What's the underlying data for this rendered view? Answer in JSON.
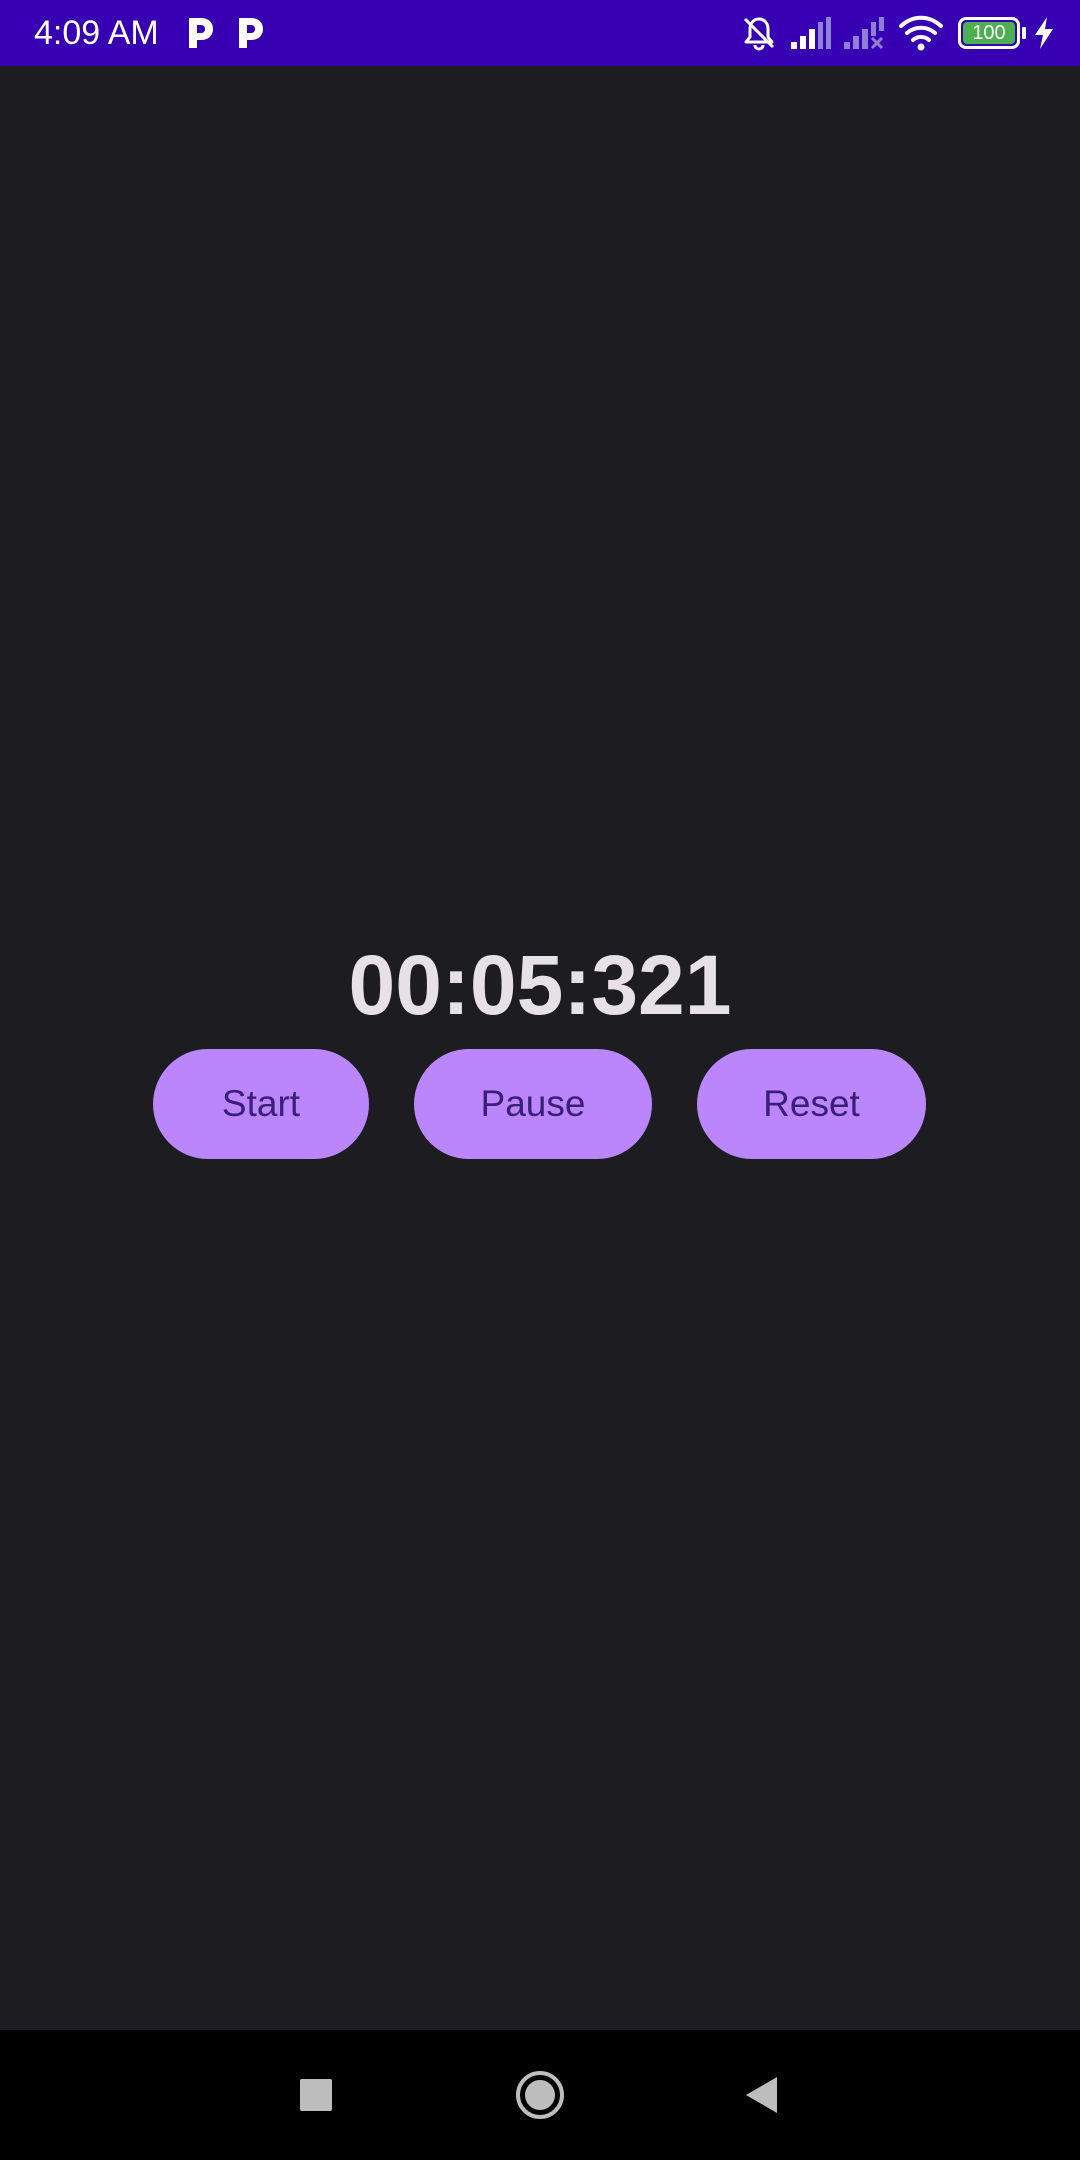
{
  "status_bar": {
    "time": "4:09 AM",
    "notification_icons": [
      "parking-app-icon",
      "parking-app-icon"
    ],
    "icons": [
      "bell-muted-icon",
      "signal-icon",
      "signal-no-service-icon",
      "wifi-icon",
      "battery-icon",
      "charging-bolt-icon"
    ],
    "battery_level": "100",
    "background_color": "#3700b3"
  },
  "stopwatch": {
    "elapsed": "00:05:321",
    "text_color": "#e6e1e5"
  },
  "controls": {
    "start_label": "Start",
    "pause_label": "Pause",
    "reset_label": "Reset",
    "button_color": "#bb86fc",
    "button_text_color": "#3b1e77"
  },
  "nav_bar": {
    "icons": [
      "recents-square-icon",
      "home-circle-icon",
      "back-triangle-icon"
    ]
  },
  "background_color": "#1d1c21"
}
